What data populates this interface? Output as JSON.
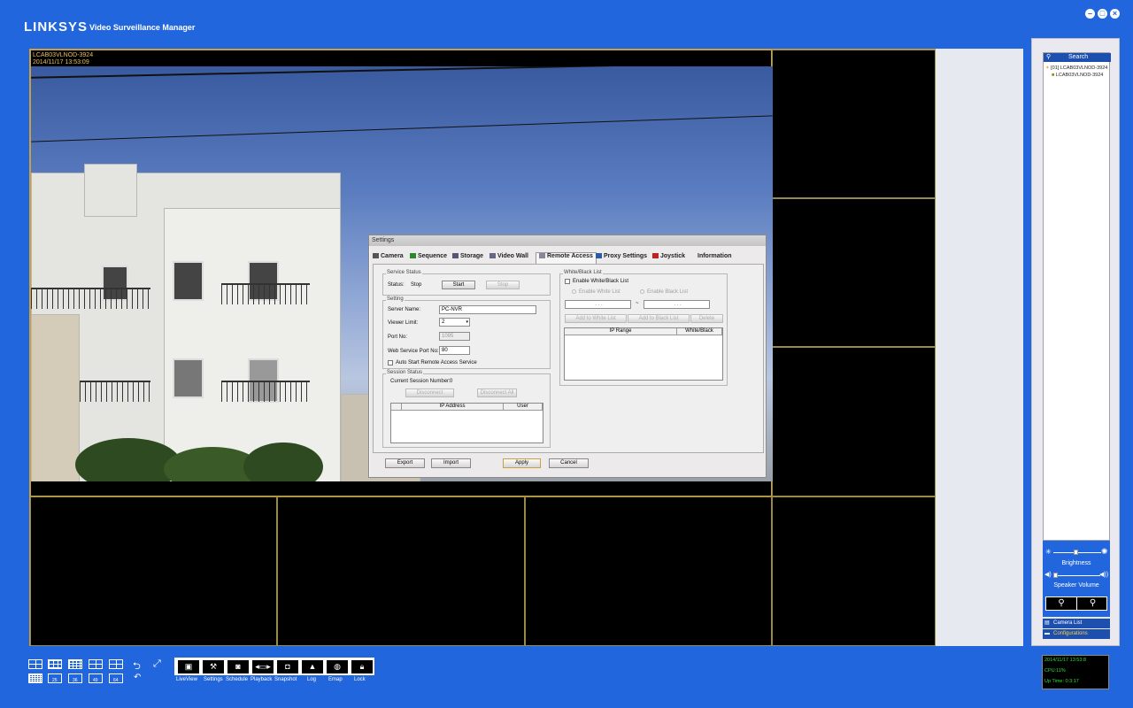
{
  "app": {
    "brand": "LINKSYS",
    "subtitle": "Video Surveillance Manager"
  },
  "window_controls": [
    "minimize-icon",
    "restore-icon",
    "close-icon"
  ],
  "camera_view": {
    "name": "LCAB03VLNOD-3924",
    "timestamp": "2014/11/17 13:53:09"
  },
  "dialog": {
    "title": "Settings",
    "tabs": [
      "Camera",
      "Sequence",
      "Storage",
      "Video Wall",
      "Remote Access",
      "Proxy Settings",
      "Joystick",
      "Information"
    ],
    "active_tab": "Remote Access",
    "service_status": {
      "group": "Service Status",
      "status_label": "Status:",
      "status_value": "Stop",
      "start": "Start",
      "stop": "Stop"
    },
    "setting": {
      "group": "Setting",
      "server_name_label": "Server Name:",
      "server_name": "PC-NVR",
      "viewer_limit_label": "Viewer Limit:",
      "viewer_limit": "2",
      "port_label": "Port No:",
      "port": "1095",
      "web_port_label": "Web Service Port No:",
      "web_port": "80",
      "auto_start": "Auto Start Remote Access Service"
    },
    "session": {
      "group": "Session Status",
      "current_label": "Current Session Number:",
      "current": "0",
      "disconnect": "Disconnect",
      "disconnect_all": "Disconnect All",
      "columns": [
        "IP Address",
        "User"
      ]
    },
    "whitelist": {
      "group": "White/Black List",
      "enable": "Enable White/Black List",
      "enable_white": "Enable White List",
      "enable_black": "Enable Black List",
      "ip_from": ".   .   .",
      "ip_sep": "~",
      "ip_to": ".   .   .",
      "add_white": "Add to White List",
      "add_black": "Add to Black List",
      "delete": "Delete",
      "columns": [
        "IP Range",
        "White/Black"
      ]
    },
    "buttons": {
      "export": "Export",
      "import": "Import",
      "apply": "Apply",
      "cancel": "Cancel"
    }
  },
  "side_panel": {
    "search": "Search",
    "tree": [
      "[01] LCAB03VLNOD-3924",
      "LCAB03VLNOD-3924"
    ],
    "brightness": "Brightness",
    "speaker_volume": "Speaker Volume",
    "tabs": [
      "Camera List",
      "Configurations"
    ]
  },
  "layouts_row1": [
    "layout-2x2-icon",
    "layout-3x3-icon",
    "layout-4x4-icon",
    "layout-1plus5-icon",
    "layout-1plus7-icon"
  ],
  "layouts_row2": [
    "",
    "25",
    "36",
    "49",
    "64"
  ],
  "toolbar": [
    "LiveView",
    "Settings",
    "Schedule",
    "Playback",
    "Snapshot",
    "Log",
    "Emap",
    "Lock"
  ],
  "status": {
    "time": "2014/11/17 13:53:8",
    "cpu": "CPU:11%",
    "uptime": "Up Time: 0:3:17"
  }
}
